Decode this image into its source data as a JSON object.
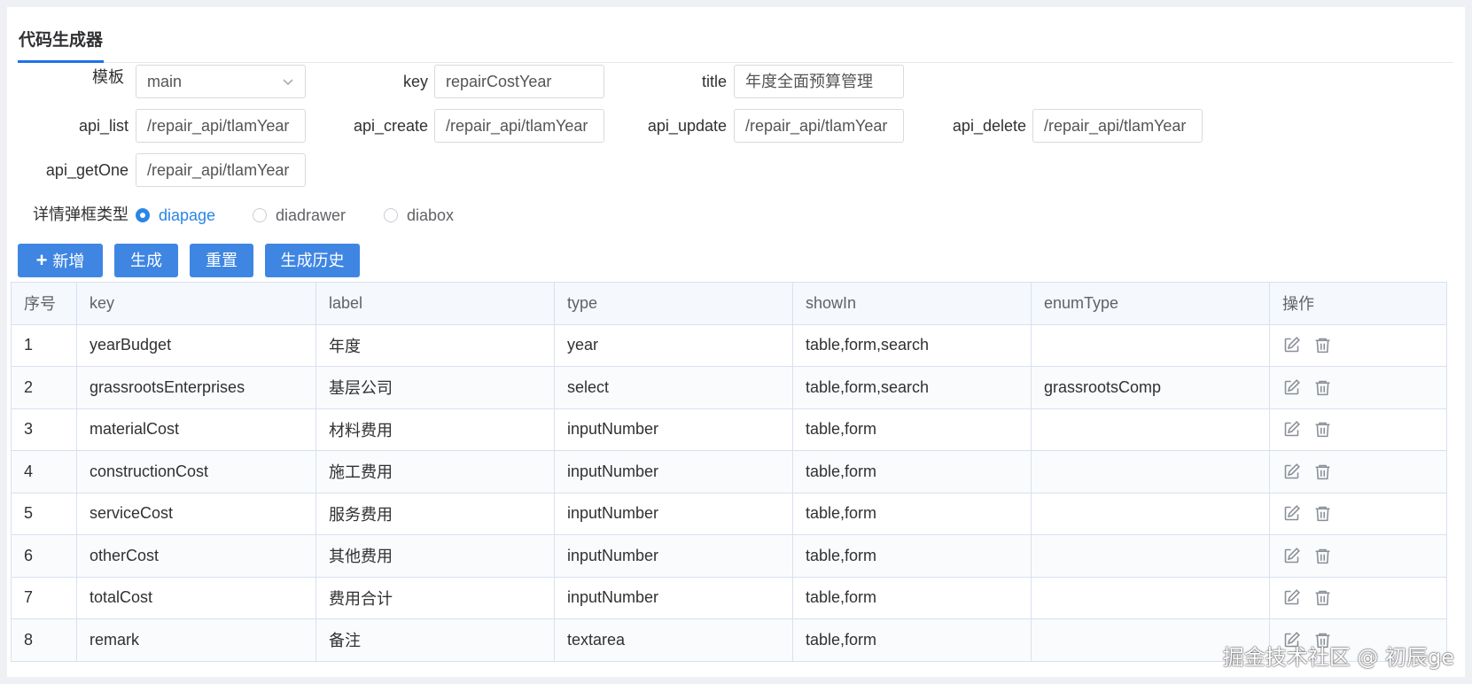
{
  "tab": {
    "title": "代码生成器"
  },
  "form": {
    "template": {
      "label": "模板",
      "value": "main"
    },
    "key": {
      "label": "key",
      "value": "repairCostYear"
    },
    "title": {
      "label": "title",
      "value": "年度全面预算管理"
    },
    "api_list": {
      "label": "api_list",
      "value": "/repair_api/tlamYear"
    },
    "api_create": {
      "label": "api_create",
      "value": "/repair_api/tlamYear"
    },
    "api_update": {
      "label": "api_update",
      "value": "/repair_api/tlamYear"
    },
    "api_delete": {
      "label": "api_delete",
      "value": "/repair_api/tlamYear"
    },
    "api_getOne": {
      "label": "api_getOne",
      "value": "/repair_api/tlamYear"
    },
    "dialog_type": {
      "label": "详情弹框类型",
      "options": [
        "diapage",
        "diadrawer",
        "diabox"
      ],
      "selected": "diapage"
    }
  },
  "buttons": {
    "add": "新增",
    "generate": "生成",
    "reset": "重置",
    "history": "生成历史"
  },
  "table": {
    "headers": [
      "序号",
      "key",
      "label",
      "type",
      "showIn",
      "enumType",
      "操作"
    ],
    "rows": [
      [
        "1",
        "yearBudget",
        "年度",
        "year",
        "table,form,search",
        ""
      ],
      [
        "2",
        "grassrootsEnterprises",
        "基层公司",
        "select",
        "table,form,search",
        "grassrootsComp"
      ],
      [
        "3",
        "materialCost",
        "材料费用",
        "inputNumber",
        "table,form",
        ""
      ],
      [
        "4",
        "constructionCost",
        "施工费用",
        "inputNumber",
        "table,form",
        ""
      ],
      [
        "5",
        "serviceCost",
        "服务费用",
        "inputNumber",
        "table,form",
        ""
      ],
      [
        "6",
        "otherCost",
        "其他费用",
        "inputNumber",
        "table,form",
        ""
      ],
      [
        "7",
        "totalCost",
        "费用合计",
        "inputNumber",
        "table,form",
        ""
      ],
      [
        "8",
        "remark",
        "备注",
        "textarea",
        "table,form",
        ""
      ]
    ],
    "row_actions": [
      "edit-icon",
      "delete-icon"
    ]
  },
  "watermark": "掘金技术社区 @ 初辰ge",
  "colors": {
    "primary": "#3f86e3",
    "radio_active": "#2a86e6",
    "tab_underline": "#1f72e8"
  }
}
